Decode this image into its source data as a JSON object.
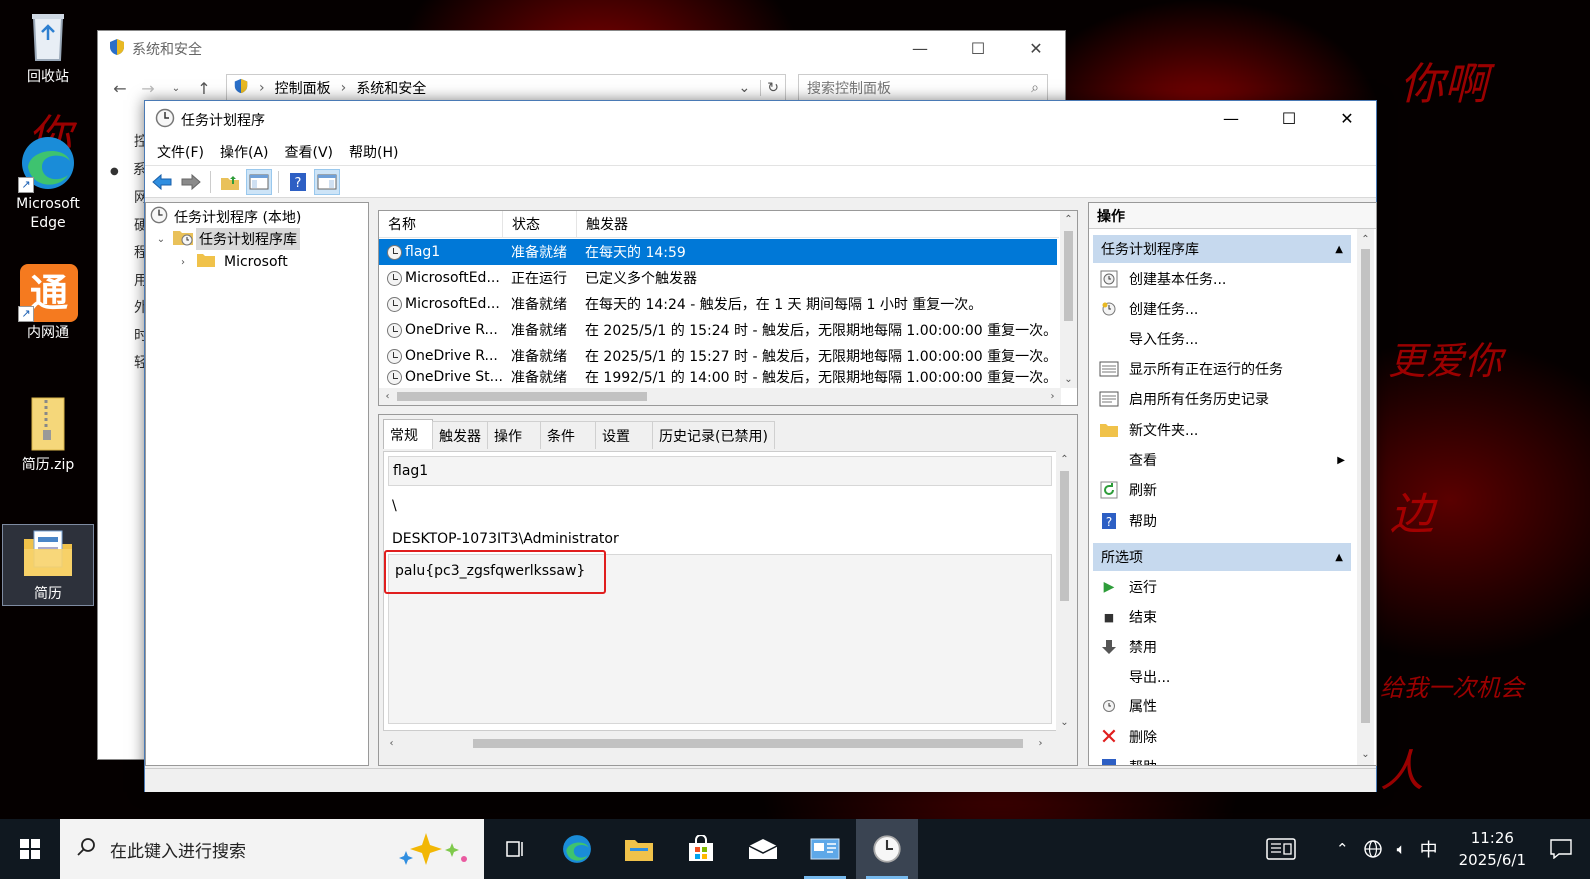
{
  "desktop": {
    "wallpaper_texts": [
      "你",
      "你",
      "你啊",
      "更爱你",
      "边",
      "给我一次机会",
      "人"
    ],
    "icons": [
      {
        "label": "回收站"
      },
      {
        "label": "Microsoft Edge"
      },
      {
        "label": "内网通"
      },
      {
        "label": "简历.zip"
      },
      {
        "label": "简历"
      }
    ]
  },
  "control_panel": {
    "title": "系统和安全",
    "breadcrumb": [
      "控制面板",
      "系统和安全"
    ],
    "search_placeholder": "搜索控制面板",
    "left_items": [
      "控",
      "系",
      "网",
      "硬",
      "程",
      "用",
      "外",
      "时",
      "轻"
    ]
  },
  "task_scheduler": {
    "title": "任务计划程序",
    "menu": [
      "文件(F)",
      "操作(A)",
      "查看(V)",
      "帮助(H)"
    ],
    "tree": {
      "root": "任务计划程序 (本地)",
      "library": "任务计划程序库",
      "child": "Microsoft"
    },
    "columns": [
      "名称",
      "状态",
      "触发器"
    ],
    "tasks": [
      {
        "name": "flag1",
        "status": "准备就绪",
        "trigger": "在每天的 14:59"
      },
      {
        "name": "MicrosoftEd...",
        "status": "正在运行",
        "trigger": "已定义多个触发器"
      },
      {
        "name": "MicrosoftEd...",
        "status": "准备就绪",
        "trigger": "在每天的 14:24 - 触发后，在 1 天 期间每隔 1 小时 重复一次。"
      },
      {
        "name": "OneDrive R...",
        "status": "准备就绪",
        "trigger": "在 2025/5/1 的 15:24 时 - 触发后，无限期地每隔 1.00:00:00 重复一次。"
      },
      {
        "name": "OneDrive R...",
        "status": "准备就绪",
        "trigger": "在 2025/5/1 的 15:27 时 - 触发后，无限期地每隔 1.00:00:00 重复一次。"
      },
      {
        "name": "OneDrive St...",
        "status": "准备就绪",
        "trigger": "在 1992/5/1 的 14:00 时 - 触发后，无限期地每隔 1.00:00:00 重复一次。"
      }
    ],
    "tabs": [
      "常规",
      "触发器",
      "操作",
      "条件",
      "设置",
      "历史记录(已禁用)"
    ],
    "general": {
      "name": "flag1",
      "location": "\\",
      "author": "DESKTOP-1073IT3\\Administrator",
      "description": "palu{pc3_zgsfqwerlkssaw}"
    },
    "actions_title": "操作",
    "sections": [
      {
        "title": "任务计划程序库",
        "items": [
          {
            "label": "创建基本任务...",
            "icon": "create-basic-task-icon"
          },
          {
            "label": "创建任务...",
            "icon": "create-task-icon"
          },
          {
            "label": "导入任务...",
            "icon": ""
          },
          {
            "label": "显示所有正在运行的任务",
            "icon": "running-tasks-icon"
          },
          {
            "label": "启用所有任务历史记录",
            "icon": "history-icon"
          },
          {
            "label": "新文件夹...",
            "icon": "new-folder-icon"
          },
          {
            "label": "查看",
            "icon": ""
          },
          {
            "label": "刷新",
            "icon": "refresh-icon"
          },
          {
            "label": "帮助",
            "icon": "help-icon"
          }
        ]
      },
      {
        "title": "所选项",
        "items": [
          {
            "label": "运行",
            "icon": "run-icon"
          },
          {
            "label": "结束",
            "icon": "stop-icon"
          },
          {
            "label": "禁用",
            "icon": "disable-icon"
          },
          {
            "label": "导出...",
            "icon": ""
          },
          {
            "label": "属性",
            "icon": "properties-icon"
          },
          {
            "label": "删除",
            "icon": "delete-icon"
          },
          {
            "label": "帮助",
            "icon": "help-icon"
          }
        ]
      }
    ]
  },
  "taskbar": {
    "search_placeholder": "在此键入进行搜索",
    "ime": "中",
    "time": "11:26",
    "date": "2025/6/1"
  },
  "colors": {
    "selection": "#0078d7",
    "section_header": "#c6d9ee",
    "highlight_box": "#e01e1e",
    "wallpaper_red": "#b40000"
  }
}
